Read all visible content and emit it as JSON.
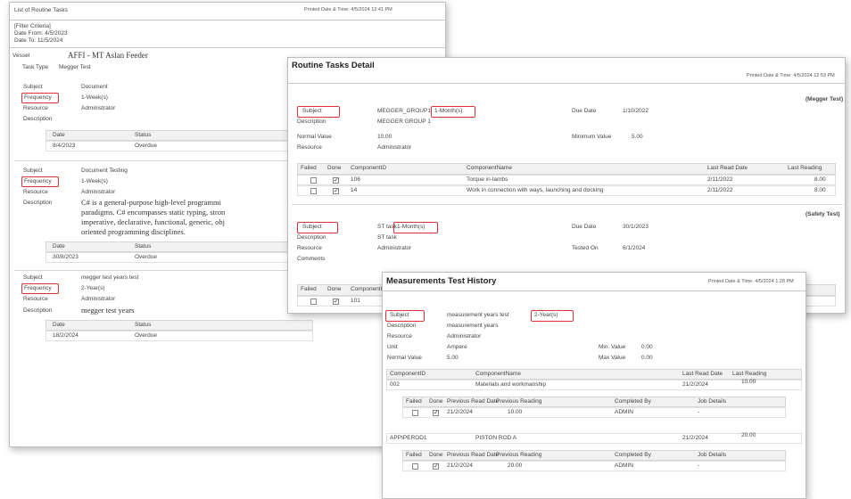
{
  "report1": {
    "title": "List of Routine Tasks",
    "printed": "Printed Date & Time: 4/5/2024 12:41 PM",
    "filter_header": "[Filter Criteria]",
    "date_from": "Date From: 4/5/2023",
    "date_to": "Date To: 11/5/2024",
    "vessel_label": "Vessel",
    "vessel_value": "AFFI - MT Aslan Feeder",
    "task_type_label": "Task Type",
    "task_type_value": "Megger Test",
    "labels": {
      "subject": "Subject",
      "frequency": "Frequency",
      "resource": "Resource",
      "description": "Description",
      "date": "Date",
      "status": "Status"
    },
    "tasks": [
      {
        "subject": "Document",
        "frequency": "1-Week(s)",
        "resource": "Administrator",
        "description": "",
        "date": "8/4/2023",
        "status": "Overdue"
      },
      {
        "subject": "Document Testing",
        "frequency": "1-Week(s)",
        "resource": "Administrator",
        "description_lines": [
          "C# is a general-purpose high-level programmi",
          "paradigms. C# encompasses static typing, stron",
          "imperative, declarative, functional, generic, obj",
          "oriented programming disciplines."
        ],
        "date": "30/8/2023",
        "status": "Overdue"
      },
      {
        "subject": "megger test years test",
        "frequency": "2-Year(s)",
        "resource": "Administrator",
        "description": "megger test years",
        "date": "18/2/2024",
        "status": "Overdue"
      }
    ]
  },
  "report2": {
    "title": "Routine Tasks Detail",
    "printed": "Printed Date & Time: 4/5/2024 12:53 PM",
    "labels": {
      "subject": "Subject",
      "description": "Description",
      "normal_value": "Normal Value",
      "resource": "Resource",
      "comments": "Comments",
      "due_date": "Due Date",
      "minimum_value": "Minimum Value",
      "tested_on": "Tested On"
    },
    "columns": [
      "Failed",
      "Done",
      "ComponentID",
      "ComponentName",
      "Last Read Date",
      "Last Reading"
    ],
    "section1": {
      "tag": "(Megger Test)",
      "subject_prefix": "MEGGER_GROUP1",
      "subject_freq": "1-Month(s)",
      "description": "MEGGER GROUP 1",
      "normal_value": "10.00",
      "resource": "Administrator",
      "due_date": "1/10/2022",
      "minimum_value": "5.00",
      "rows": [
        {
          "failed": false,
          "done": true,
          "id": "106",
          "name": "Torque in-lambs",
          "date": "2/11/2022",
          "reading": "8.00"
        },
        {
          "failed": false,
          "done": true,
          "id": "14",
          "name": "Work in connection with ways, launching and docking",
          "date": "2/11/2022",
          "reading": "8.00"
        }
      ]
    },
    "section2": {
      "tag": "(Safety Test)",
      "subject_prefix": "ST task",
      "subject_freq": "1-Month(s)",
      "description": "ST task",
      "resource": "Administrator",
      "comments": "",
      "due_date": "30/1/2023",
      "tested_on": "6/1/2024",
      "row": {
        "failed": false,
        "done": true,
        "id": "101"
      }
    }
  },
  "report3": {
    "title": "Measurements Test History",
    "printed": "Printed Date & Time: 4/5/2024 1:28 PM",
    "labels": {
      "subject": "Subject",
      "description": "Description",
      "resource": "Resource",
      "unit": "Unit",
      "normal_value": "Normal Value",
      "min_value": "Min. Value",
      "max_value": "Max Value"
    },
    "subject_prefix": "measurement years test",
    "subject_freq": "2-Year(s)",
    "description": "measurement years",
    "resource": "Administrator",
    "unit": "Ampere",
    "normal_value": "5.00",
    "min_value": "0.00",
    "max_value": "0.00",
    "component_columns": [
      "ComponentID",
      "ComponentName",
      "Last Read Date",
      "Last Reading"
    ],
    "history_columns": [
      "Failed",
      "Done",
      "Previous Read Date",
      "Previous Reading",
      "Completed By",
      "Job Details"
    ],
    "components": [
      {
        "id": "002",
        "name": "Materials and workmanship",
        "date": "21/2/2024",
        "reading": "10.00",
        "history": {
          "failed": false,
          "done": true,
          "date": "21/2/2024",
          "reading": "10.00",
          "by": "ADMIN",
          "details": "-"
        }
      },
      {
        "id": "APPIPEROD1",
        "name": "PISTON ROD A",
        "date": "21/2/2024",
        "reading": "20.00",
        "history": {
          "failed": false,
          "done": true,
          "date": "21/2/2024",
          "reading": "20.00",
          "by": "ADMIN",
          "details": "-"
        }
      }
    ]
  },
  "colors": {
    "highlight": "#e0303c",
    "border": "#bdbdbd"
  }
}
